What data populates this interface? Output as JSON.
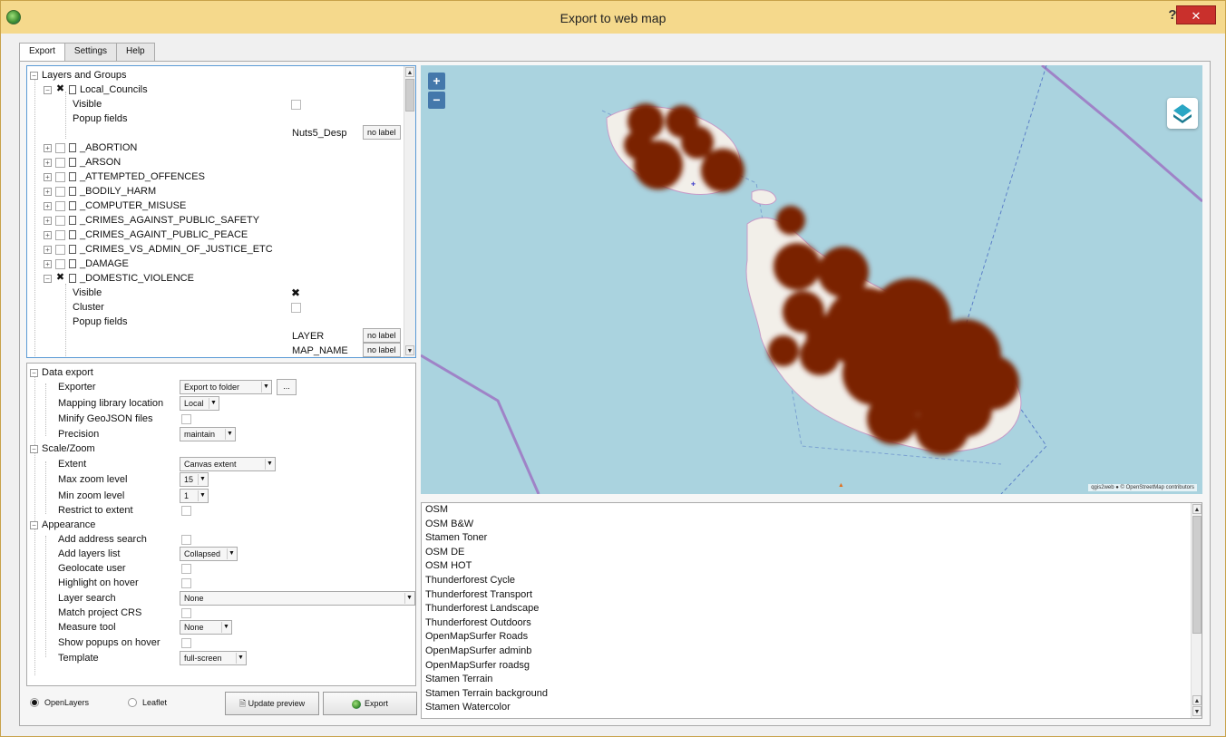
{
  "window": {
    "title": "Export to web map",
    "help_label": "?",
    "close_label": "✕"
  },
  "tabs": [
    {
      "label": "Export",
      "active": true
    },
    {
      "label": "Settings",
      "active": false
    },
    {
      "label": "Help",
      "active": false
    }
  ],
  "layers_tree": {
    "root_label": "Layers and Groups",
    "local_councils": {
      "name": "Local_Councils",
      "checked": true,
      "visible_label": "Visible",
      "popup_fields_label": "Popup fields",
      "field_name": "Nuts5_Desp",
      "field_value": "no label"
    },
    "layers": [
      {
        "name": "_ABORTION"
      },
      {
        "name": "_ARSON"
      },
      {
        "name": "_ATTEMPTED_OFFENCES"
      },
      {
        "name": "_BODILY_HARM"
      },
      {
        "name": "_COMPUTER_MISUSE"
      },
      {
        "name": "_CRIMES_AGAINST_PUBLIC_SAFETY"
      },
      {
        "name": "_CRIMES_AGAINT_PUBLIC_PEACE"
      },
      {
        "name": "_CRIMES_VS_ADMIN_OF_JUSTICE_ETC"
      },
      {
        "name": "_DAMAGE"
      }
    ],
    "domestic_violence": {
      "name": "_DOMESTIC_VIOLENCE",
      "checked": true,
      "visible_label": "Visible",
      "visible_checked": true,
      "cluster_label": "Cluster",
      "popup_fields_label": "Popup fields",
      "fields": [
        {
          "name": "LAYER",
          "value": "no label"
        },
        {
          "name": "MAP_NAME",
          "value": "no label"
        }
      ]
    }
  },
  "settings": {
    "data_export": {
      "label": "Data export",
      "exporter": {
        "label": "Exporter",
        "value": "Export to folder",
        "browse": "..."
      },
      "mapping_library": {
        "label": "Mapping library location",
        "value": "Local"
      },
      "minify": {
        "label": "Minify GeoJSON files"
      },
      "precision": {
        "label": "Precision",
        "value": "maintain"
      }
    },
    "scale_zoom": {
      "label": "Scale/Zoom",
      "extent": {
        "label": "Extent",
        "value": "Canvas extent"
      },
      "max_zoom": {
        "label": "Max zoom level",
        "value": "15"
      },
      "min_zoom": {
        "label": "Min zoom level",
        "value": "1"
      },
      "restrict": {
        "label": "Restrict to extent"
      }
    },
    "appearance": {
      "label": "Appearance",
      "add_address_search": {
        "label": "Add address search"
      },
      "add_layers_list": {
        "label": "Add layers list",
        "value": "Collapsed"
      },
      "geolocate_user": {
        "label": "Geolocate user"
      },
      "highlight_on_hover": {
        "label": "Highlight on hover"
      },
      "layer_search": {
        "label": "Layer search",
        "value": "None"
      },
      "match_project_crs": {
        "label": "Match project CRS"
      },
      "measure_tool": {
        "label": "Measure tool",
        "value": "None"
      },
      "show_popups_on_hover": {
        "label": "Show popups on hover"
      },
      "template": {
        "label": "Template",
        "value": "full-screen"
      }
    }
  },
  "bottom": {
    "openlayers_label": "OpenLayers",
    "leaflet_label": "Leaflet",
    "selected": "OpenLayers",
    "update_preview_label": "Update preview",
    "export_label": "Export"
  },
  "map": {
    "zoom_in": "+",
    "zoom_out": "−",
    "attribution": "qgis2web ● © OpenStreetMap contributors",
    "heat_color": "#7a2000",
    "water_color": "#aad3df"
  },
  "basemaps": [
    "OSM",
    "OSM B&W",
    "Stamen Toner",
    "OSM DE",
    "OSM HOT",
    "Thunderforest Cycle",
    "Thunderforest Transport",
    "Thunderforest Landscape",
    "Thunderforest Outdoors",
    "OpenMapSurfer Roads",
    "OpenMapSurfer adminb",
    "OpenMapSurfer roadsg",
    "Stamen Terrain",
    "Stamen Terrain background",
    "Stamen Watercolor"
  ]
}
